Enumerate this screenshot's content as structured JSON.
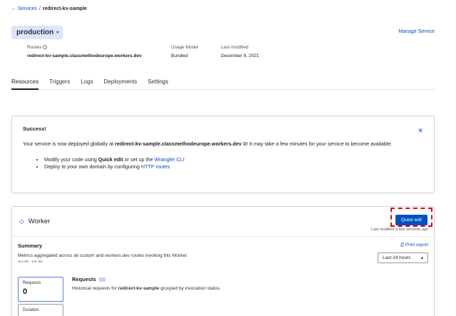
{
  "breadcrumb": {
    "back_arrow": "←",
    "services": "Services",
    "separator": "/",
    "current": "redirect-kv-sample"
  },
  "environment": {
    "selected": "production",
    "chevron": "▾"
  },
  "manage_service": "Manage Service",
  "meta": {
    "routes_label": "Routes",
    "routes_info_icon": "i",
    "routes_value": "redirect-kv-sample.classmethodeurope.workers.dev",
    "usage_label": "Usage Model",
    "usage_value": "Bundled",
    "modified_label": "Last modified",
    "modified_value": "December 9, 2021"
  },
  "tabs": [
    {
      "label": "Resources",
      "active": true
    },
    {
      "label": "Triggers",
      "active": false
    },
    {
      "label": "Logs",
      "active": false
    },
    {
      "label": "Deployments",
      "active": false
    },
    {
      "label": "Settings",
      "active": false
    }
  ],
  "alert": {
    "title": "Success!",
    "close": "✕",
    "body_prefix": "Your service is now deployed globally at ",
    "body_domain": "redirect-kv-sample.classmethodeurope.workers.dev",
    "body_ext": "⧉",
    "body_suffix": "! It may take a few minutes for your service to become available.",
    "bullet1_prefix": "Modify your code using ",
    "bullet1_bold": "Quick edit",
    "bullet1_mid": " or set up the ",
    "bullet1_link": "Wrangler CLI",
    "bullet2_prefix": "Deploy to your own domain by configuring ",
    "bullet2_link": "HTTP routes"
  },
  "worker": {
    "icon": "◇",
    "title": "Worker",
    "quick_edit": "Quick edit",
    "last_modified": "Last modified a few seconds ago",
    "summary_label": "Summary",
    "summary_desc": "Metrics aggregated across all custom and workers.dev routes invoking this Worker.",
    "summary_dates": "Dec 8th - Dec 9th",
    "print_icon": "⎙",
    "print_report": "Print report",
    "range_value": "Last 24 hours",
    "range_chevron": "▾",
    "metric_requests_label": "Requests",
    "metric_requests_value": "0",
    "metric_duration_label": "Duration",
    "requests_title": "Requests",
    "requests_desc_prefix": "Historical requests for ",
    "requests_desc_bold": "redirect-kv-sample",
    "requests_desc_suffix": " grouped by invocation status."
  },
  "colors": {
    "accent": "#0051c3",
    "highlight": "#e0001b",
    "env_bg": "#dbe6f7"
  }
}
